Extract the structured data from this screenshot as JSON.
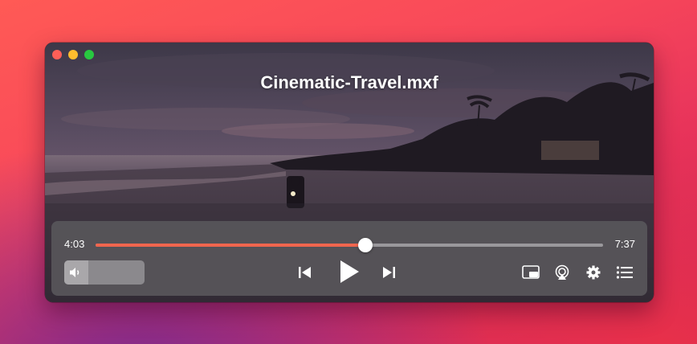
{
  "window": {
    "title": "Cinematic-Travel.mxf"
  },
  "playback": {
    "current_time": "4:03",
    "total_time": "7:37",
    "progress": 0.532,
    "volume_level": 0.3,
    "state": "paused"
  },
  "icons": {
    "volume": "speaker-icon",
    "previous": "skip-previous-icon",
    "play": "play-icon",
    "next": "skip-next-icon",
    "pip": "picture-in-picture-icon",
    "airplay": "airplay-icon",
    "settings": "gear-icon",
    "playlist": "list-icon"
  },
  "colors": {
    "accent": "#f0654e",
    "control_bar": "#58565a"
  }
}
